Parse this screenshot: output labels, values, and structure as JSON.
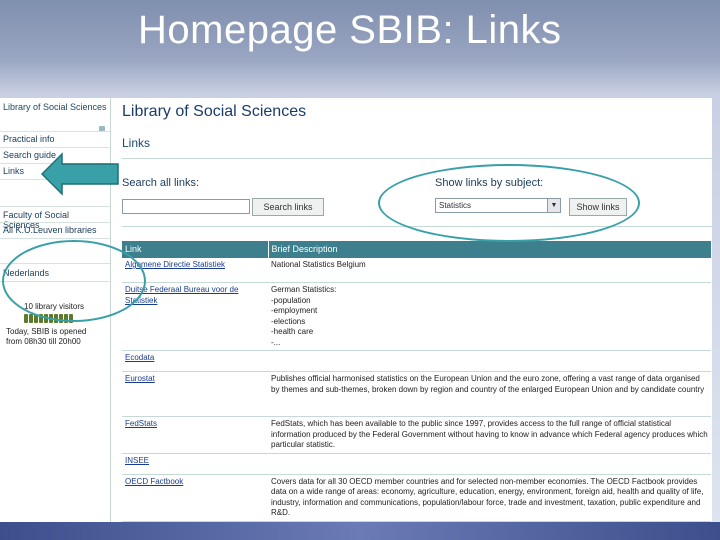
{
  "slide": {
    "title": "Homepage SBIB: Links"
  },
  "sidebar": {
    "brand": "Library of Social Sciences",
    "nav": [
      {
        "label": "Practical info"
      },
      {
        "label": "Search guide"
      },
      {
        "label": "Links"
      },
      {
        "label": "Faculty of Social Sciences"
      },
      {
        "label": "All K.U.Leuven libraries"
      },
      {
        "label": "Nederlands"
      }
    ],
    "visitors": {
      "count_label": "10 library visitors",
      "note": "Today, SBIB is opened from 08h30 till 20h00"
    }
  },
  "main": {
    "site_title": "Library of Social Sciences",
    "page_label": "Links",
    "search": {
      "label": "Search all links:",
      "value": "",
      "button": "Search links"
    },
    "subject": {
      "label": "Show links by subject:",
      "selected": "Statistics",
      "button": "Show links"
    },
    "table": {
      "columns": [
        "Link",
        "Brief Description"
      ],
      "rows": [
        {
          "link": "Algemene Directie Statistiek",
          "desc": [
            "National Statistics Belgium"
          ]
        },
        {
          "link": "Duitse Federaal Bureau voor de Statistiek",
          "desc": [
            "German Statistics:",
            "-population",
            "-employment",
            "-elections",
            "-health care",
            "-..."
          ]
        },
        {
          "link": "Ecodata",
          "desc": [
            ""
          ]
        },
        {
          "link": "Eurostat",
          "desc": [
            "Publishes official harmonised statistics on the European Union and the euro zone, offering a vast range of data organised by themes and sub-themes, broken down by region and country of the enlarged European Union and by candidate country"
          ]
        },
        {
          "link": "FedStats",
          "desc": [
            "FedStats, which has been available to the public since 1997, provides access to the full range of official statistical information produced by the Federal Government without having to know in advance which Federal agency produces which particular statistic."
          ]
        },
        {
          "link": "INSEE",
          "desc": [
            ""
          ]
        },
        {
          "link": "OECD Factbook",
          "desc": [
            "Covers data for all 30 OECD member countries and for selected non-member economies. The OECD Factbook provides data on a wide range of areas: economy, agriculture, education, energy, environment, foreign aid, health and quality of life, industry, information and communications, population/labour force, trade and investment, taxation, public expenditure and R&D."
          ]
        }
      ]
    }
  },
  "annotations": {
    "color": "#3aa0a8"
  }
}
